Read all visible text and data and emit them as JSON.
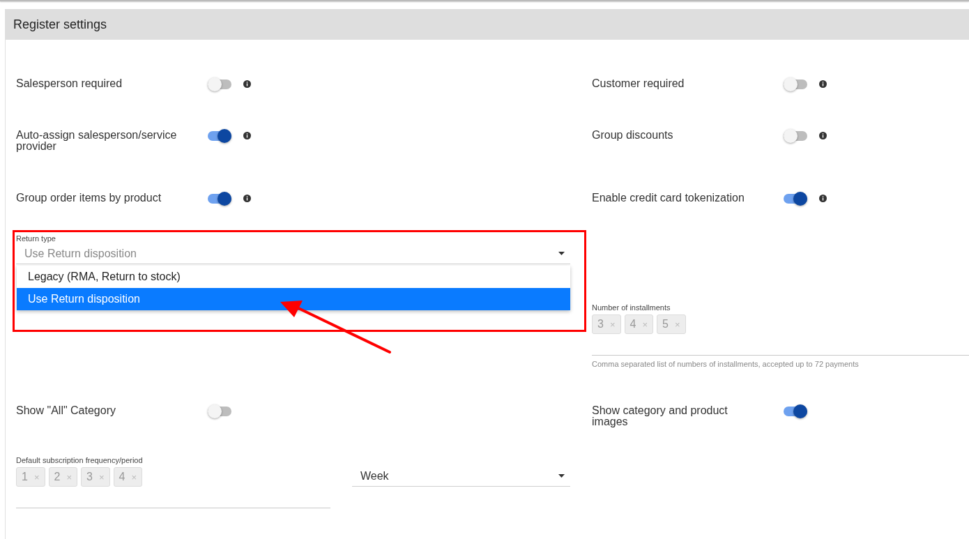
{
  "panel": {
    "title": "Register settings"
  },
  "rows": [
    {
      "left": {
        "kind": "toggle",
        "label": "Salesperson required",
        "on": false,
        "info": true
      },
      "right": {
        "kind": "toggle",
        "label": "Customer required",
        "on": false,
        "info": true
      }
    },
    {
      "left": {
        "kind": "toggle",
        "label": "Auto-assign salesperson/service provider",
        "on": true,
        "info": true
      },
      "right": {
        "kind": "toggle",
        "label": "Group discounts",
        "on": false,
        "info": true
      }
    },
    {
      "left": {
        "kind": "toggle",
        "label": "Group order items by product",
        "on": true,
        "info": true
      },
      "right": {
        "kind": "toggle",
        "label": "Enable credit card tokenization",
        "on": true,
        "info": true
      }
    },
    {
      "left": {
        "kind": "select",
        "label": "Return type",
        "value": "Use Return disposition",
        "expanded": true,
        "options": [
          {
            "label": "Legacy (RMA, Return to stock)",
            "selected": false
          },
          {
            "label": "Use Return disposition",
            "selected": true
          }
        ]
      },
      "right": {
        "kind": "chips",
        "label": "Number of installments",
        "chips": [
          {
            "text": "3",
            "remove": "×"
          },
          {
            "text": "4",
            "remove": "×"
          },
          {
            "text": "5",
            "remove": "×"
          }
        ],
        "helper": "Comma separated list of numbers of installments, accepted up to 72 payments"
      }
    },
    {
      "left": {
        "kind": "toggle",
        "label": "Show \"All\" Category",
        "on": false,
        "info": false
      },
      "right": {
        "kind": "toggle",
        "label": "Show category and product images",
        "on": true,
        "info": false
      }
    },
    {
      "left": {
        "kind": "period",
        "label": "Default subscription frequency/period",
        "chips": [
          {
            "text": "1",
            "remove": "×"
          },
          {
            "text": "2",
            "remove": "×"
          },
          {
            "text": "3",
            "remove": "×"
          },
          {
            "text": "4",
            "remove": "×"
          }
        ],
        "unit": "Week"
      }
    }
  ]
}
